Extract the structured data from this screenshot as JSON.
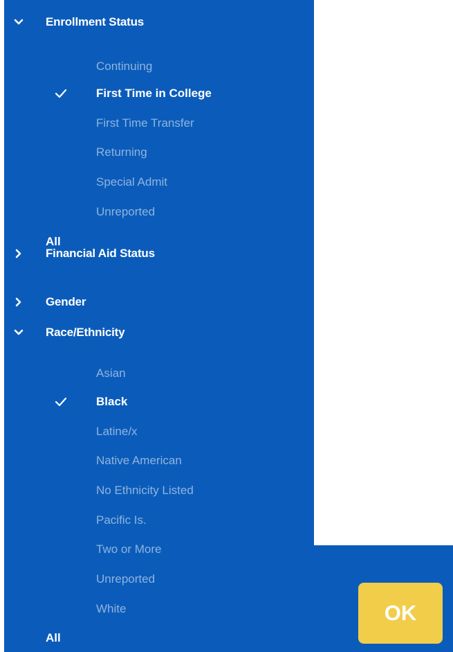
{
  "colors": {
    "panel_bg": "#0b5cba",
    "text_selected": "#ffffff",
    "text_unselected": "#8fb4de",
    "ok_button_bg": "#f2cd4a",
    "ok_text": "#ffffff"
  },
  "icons": {
    "expanded": "chevron-down-icon",
    "collapsed": "chevron-right-icon",
    "selected": "checkmark-icon"
  },
  "filters": [
    {
      "label": "Enrollment Status",
      "expanded": true,
      "options": [
        {
          "label": "Continuing",
          "selected": false
        },
        {
          "label": "First Time in College",
          "selected": true
        },
        {
          "label": "First Time Transfer",
          "selected": false
        },
        {
          "label": "Returning",
          "selected": false
        },
        {
          "label": "Special Admit",
          "selected": false
        },
        {
          "label": "Unreported",
          "selected": false
        }
      ],
      "all_label": "All"
    },
    {
      "label": "Financial Aid Status",
      "expanded": false
    },
    {
      "label": "Gender",
      "expanded": false
    },
    {
      "label": "Race/Ethnicity",
      "expanded": true,
      "options": [
        {
          "label": "Asian",
          "selected": false
        },
        {
          "label": "Black",
          "selected": true
        },
        {
          "label": "Latine/x",
          "selected": false
        },
        {
          "label": "Native American",
          "selected": false
        },
        {
          "label": "No Ethnicity Listed",
          "selected": false
        },
        {
          "label": "Pacific Is.",
          "selected": false
        },
        {
          "label": "Two or More",
          "selected": false
        },
        {
          "label": "Unreported",
          "selected": false
        },
        {
          "label": "White",
          "selected": false
        }
      ],
      "all_label": "All"
    }
  ],
  "ok_button": {
    "label": "OK"
  }
}
